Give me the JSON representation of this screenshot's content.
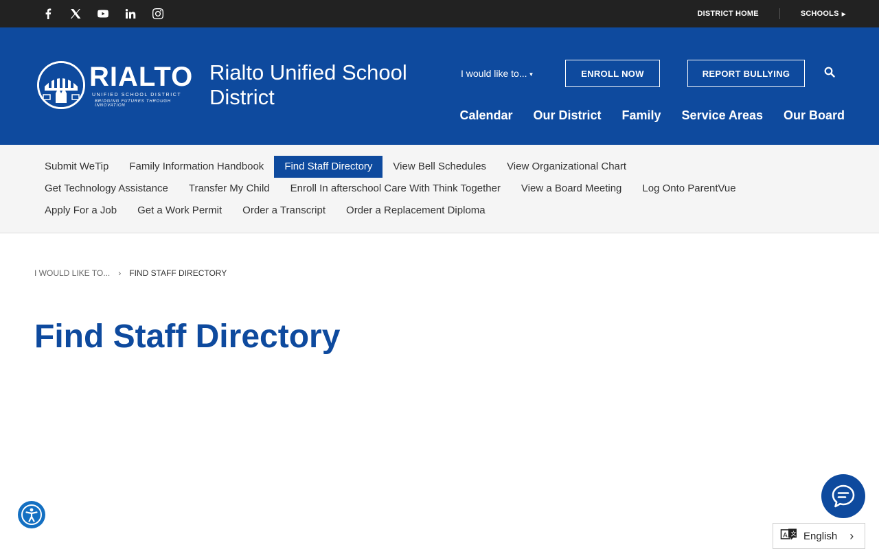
{
  "topbar": {
    "social": [
      "facebook-icon",
      "x-icon",
      "youtube-icon",
      "linkedin-icon",
      "instagram-icon"
    ],
    "district_home": "DISTRICT HOME",
    "schools": "SCHOOLS"
  },
  "header": {
    "logo_wordmark": "RIALTO",
    "logo_sub1": "UNIFIED SCHOOL DISTRICT",
    "logo_sub2": "BRIDGING FUTURES THROUGH INNOVATION",
    "site_title": "Rialto Unified School District",
    "would_like": "I would like to...",
    "enroll": "ENROLL NOW",
    "report": "REPORT BULLYING",
    "nav": [
      "Calendar",
      "Our District",
      "Family",
      "Service Areas",
      "Our Board"
    ]
  },
  "quick_links": {
    "row1": [
      "Submit WeTip",
      "Family Information Handbook",
      "Find Staff Directory",
      "View Bell Schedules",
      "View Organizational Chart"
    ],
    "row2": [
      "Get Technology Assistance",
      "Transfer My Child",
      "Enroll In afterschool Care With Think Together",
      "View a Board Meeting",
      "Log Onto ParentVue"
    ],
    "row3": [
      "Apply For a Job",
      "Get a Work Permit",
      "Order a Transcript",
      "Order a Replacement Diploma"
    ],
    "active": "Find Staff Directory"
  },
  "breadcrumb": {
    "parent": "I WOULD LIKE TO...",
    "current": "FIND STAFF DIRECTORY"
  },
  "page": {
    "title": "Find Staff Directory"
  },
  "language": {
    "label": "English"
  },
  "colors": {
    "brand_blue": "#0e4a9e",
    "topbar": "#222222",
    "quick_bg": "#f5f5f5",
    "accessibility": "#1470c2"
  }
}
